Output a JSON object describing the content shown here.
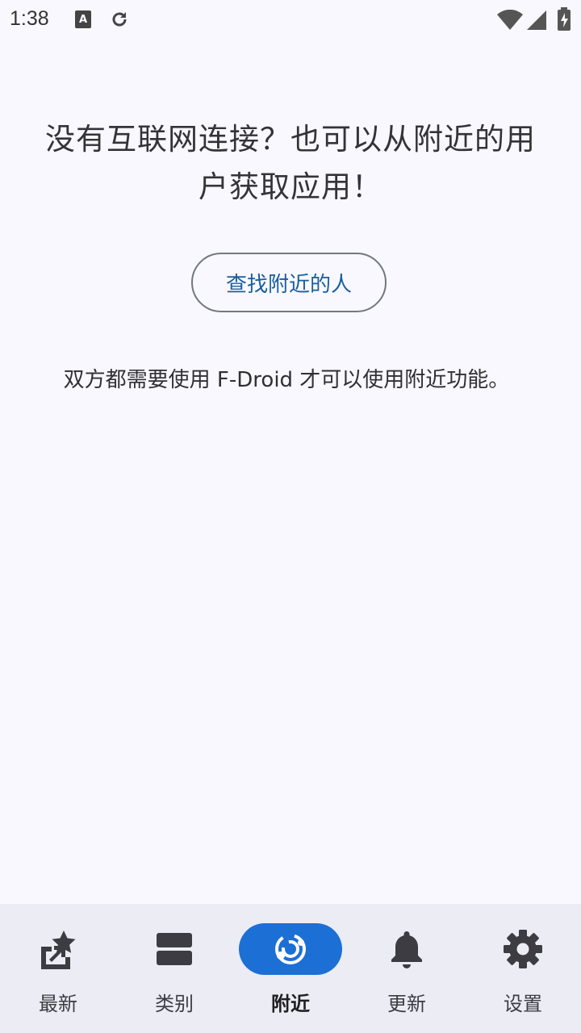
{
  "status_bar": {
    "time": "1:38",
    "icons": [
      "keyboard-a-icon",
      "sync-icon",
      "wifi-icon",
      "signal-icon",
      "battery-icon"
    ]
  },
  "nearby": {
    "headline": "没有互联网连接？也可以从附近的用户获取应用！",
    "find_button_label": "查找附近的人",
    "info_text": "双方都需要使用 F-Droid 才可以使用附近功能。"
  },
  "bottom_nav": {
    "items": [
      {
        "label": "最新",
        "icon": "new-star-icon",
        "active": false
      },
      {
        "label": "类别",
        "icon": "categories-icon",
        "active": false
      },
      {
        "label": "附近",
        "icon": "nearby-icon",
        "active": true
      },
      {
        "label": "更新",
        "icon": "bell-icon",
        "active": false
      },
      {
        "label": "设置",
        "icon": "gear-icon",
        "active": false
      }
    ]
  },
  "colors": {
    "accent": "#1c6fd4",
    "button_text": "#1a5e9c",
    "background": "#f8f8fe",
    "nav_background": "#ececf4"
  }
}
